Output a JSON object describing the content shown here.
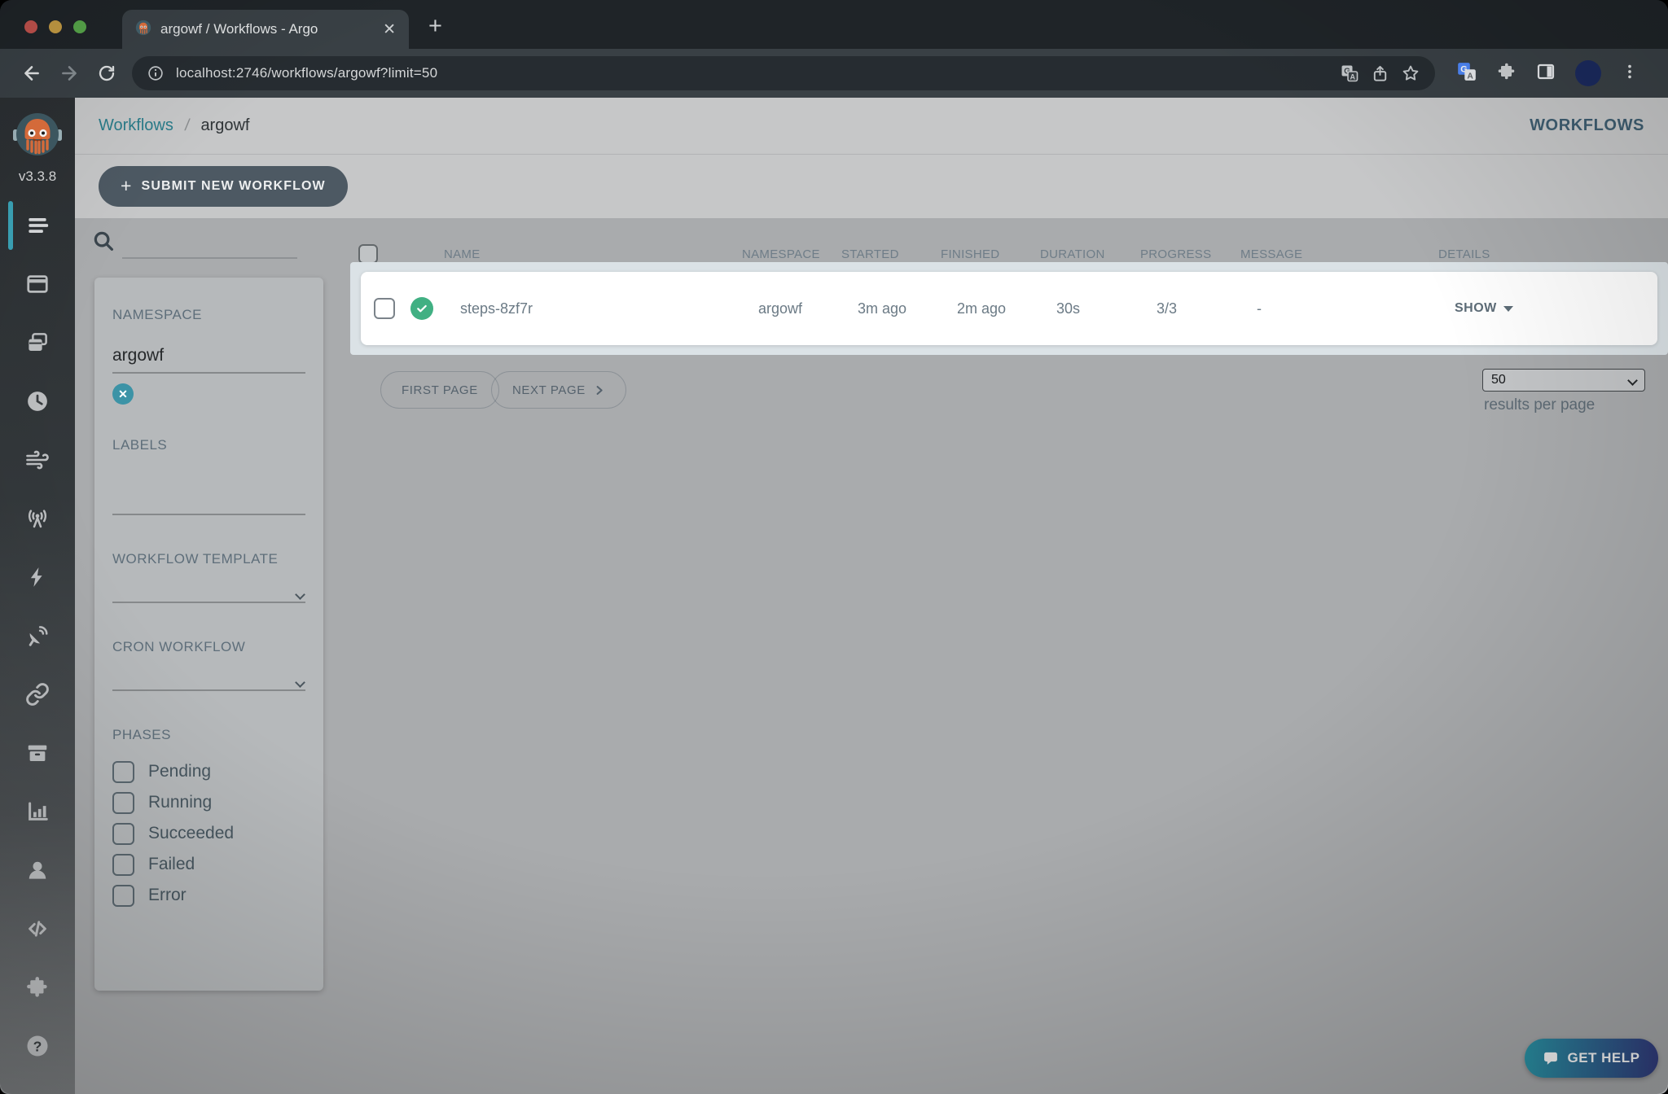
{
  "browser": {
    "tab_title": "argowf / Workflows - Argo",
    "close_glyph": "✕",
    "new_tab_glyph": "+",
    "url": "localhost:2746/workflows/argowf?limit=50"
  },
  "sidebar": {
    "version": "v3.3.8"
  },
  "header": {
    "breadcrumb_root": "Workflows",
    "breadcrumb_separator": "/",
    "breadcrumb_current": "argowf",
    "page_title": "WORKFLOWS"
  },
  "actions": {
    "submit_plus": "+",
    "submit_label": "SUBMIT NEW WORKFLOW"
  },
  "table": {
    "columns": [
      "NAME",
      "NAMESPACE",
      "STARTED",
      "FINISHED",
      "DURATION",
      "PROGRESS",
      "MESSAGE",
      "DETAILS"
    ],
    "rows": [
      {
        "name": "steps-8zf7r",
        "namespace": "argowf",
        "started": "3m ago",
        "finished": "2m ago",
        "duration": "30s",
        "progress": "3/3",
        "message": "-",
        "details": "SHOW",
        "status": "succeeded"
      }
    ]
  },
  "pagination": {
    "first_label": "FIRST PAGE",
    "next_label": "NEXT PAGE",
    "per_page": "50",
    "per_page_caption": "results per page"
  },
  "filters": {
    "namespace_label": "NAMESPACE",
    "namespace_value": "argowf",
    "labels_label": "LABELS",
    "workflow_template_label": "WORKFLOW TEMPLATE",
    "cron_workflow_label": "CRON WORKFLOW",
    "phases_label": "PHASES",
    "phases": [
      "Pending",
      "Running",
      "Succeeded",
      "Failed",
      "Error"
    ]
  },
  "help": {
    "label": "GET HELP"
  },
  "colors": {
    "accent_teal": "#3c93a6",
    "active_nav_teal": "#3ba4b8",
    "success_green": "#41b083",
    "link_teal": "#2a7c8a",
    "title_blue": "#3e5d70",
    "help_gradient_start": "#2b96a9",
    "help_gradient_end": "#333d80",
    "row_highlight": "#dbe2e6"
  }
}
